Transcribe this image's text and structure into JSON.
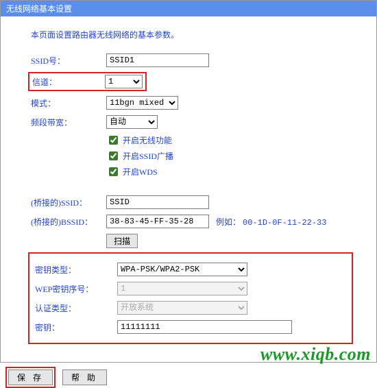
{
  "title": "无线网络基本设置",
  "intro": "本页面设置路由器无线网络的基本参数。",
  "labels": {
    "ssid": "SSID号：",
    "channel": "信道：",
    "mode": "模式：",
    "bandwidth": "频段带宽：",
    "bridged_ssid": "(桥接的)SSID：",
    "bridged_bssid": "(桥接的)BSSID：",
    "keytype": "密钥类型：",
    "wep_index": "WEP密钥序号：",
    "auth_type": "认证类型：",
    "key": "密钥："
  },
  "values": {
    "ssid": "SSID1",
    "channel": "1",
    "mode": "11bgn mixed",
    "bandwidth": "自动",
    "bridged_ssid": "SSID",
    "bridged_bssid": "38-83-45-FF-35-28",
    "keytype": "WPA-PSK/WPA2-PSK",
    "wep_index": "1",
    "auth_type": "开放系统",
    "key": "11111111"
  },
  "checks": {
    "enable_wireless": "开启无线功能",
    "enable_ssid_broadcast": "开启SSID广播",
    "enable_wds": "开启WDS"
  },
  "example_prefix": "例如：",
  "example_value": "00-1D-0F-11-22-33",
  "buttons": {
    "scan": "扫描",
    "save": "保 存",
    "help": "帮 助"
  },
  "watermark": "www.xiqb.com"
}
